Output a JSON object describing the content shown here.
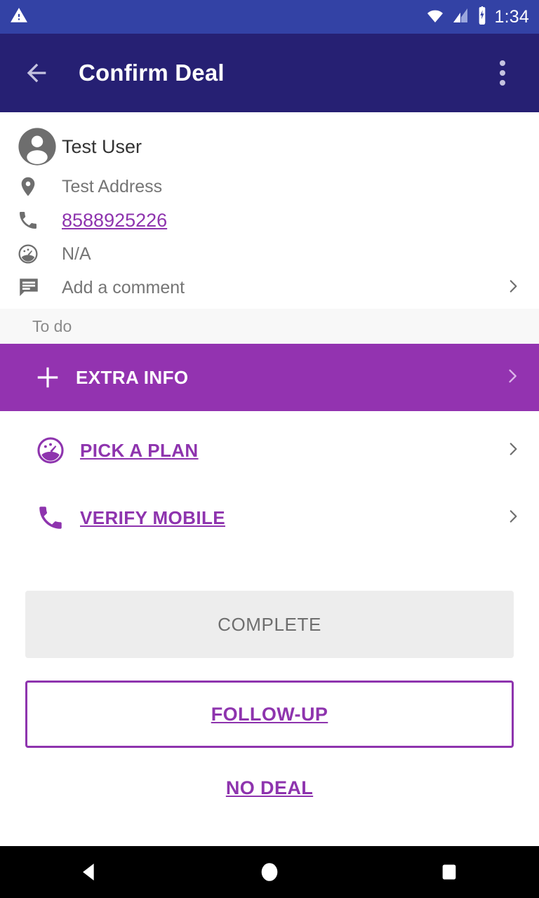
{
  "status_bar": {
    "warning_icon": "warning-triangle-icon",
    "wifi_icon": "wifi-icon",
    "signal_icon": "cell-signal-icon",
    "battery_icon": "battery-charging-icon",
    "time": "1:34",
    "background_color": "#3342a5"
  },
  "app_bar": {
    "back_icon": "back-arrow-icon",
    "title": "Confirm Deal",
    "overflow_icon": "overflow-menu-icon",
    "background_color": "#262073"
  },
  "contact": {
    "avatar_icon": "person-avatar-icon",
    "name": "Test User",
    "address_icon": "location-pin-icon",
    "address": "Test Address",
    "phone_icon": "phone-icon",
    "phone": "8588925226",
    "plan_icon": "speedometer-icon",
    "plan": "N/A",
    "comment_icon": "comment-icon",
    "comment_placeholder": "Add a comment",
    "comment_chevron_icon": "chevron-right-icon"
  },
  "todo": {
    "section_label": "To do",
    "banner": {
      "plus_icon": "plus-icon",
      "label": "EXTRA INFO",
      "chevron_icon": "chevron-right-icon",
      "background_color": "#9333b0"
    },
    "tasks": [
      {
        "icon": "speedometer-icon",
        "label": "PICK A PLAN",
        "chevron_icon": "chevron-right-icon"
      },
      {
        "icon": "phone-icon",
        "label": "VERIFY MOBILE",
        "chevron_icon": "chevron-right-icon"
      }
    ]
  },
  "actions": {
    "complete_label": "COMPLETE",
    "followup_label": "FOLLOW-UP",
    "nodeal_label": "NO DEAL",
    "accent_color": "#8e34ae",
    "disabled_color": "#ededed"
  },
  "nav_bar": {
    "back_icon": "nav-back-triangle-icon",
    "home_icon": "nav-home-circle-icon",
    "recents_icon": "nav-recents-square-icon"
  }
}
